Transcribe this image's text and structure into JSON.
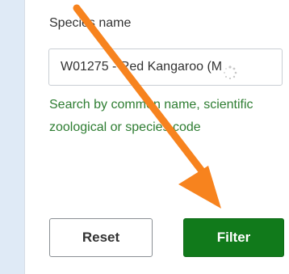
{
  "species_filter": {
    "label": "Species name",
    "input_value": "W01275 - Red Kangaroo (M",
    "help_text": "Search by common name, scientific zoological or species code"
  },
  "actions": {
    "reset_label": "Reset",
    "filter_label": "Filter"
  },
  "annotation": {
    "icon": "arrow-annotation-icon",
    "color": "#f7831e"
  },
  "colors": {
    "help_text": "#2e7d32",
    "filter_button": "#117a1b"
  }
}
